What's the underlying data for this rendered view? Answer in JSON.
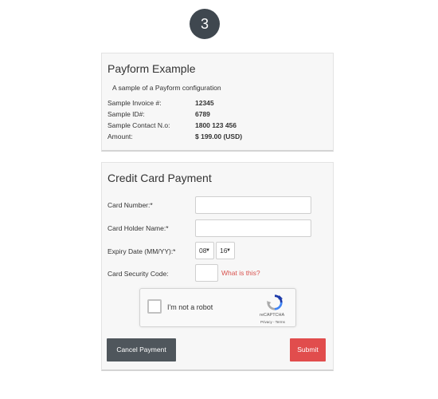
{
  "step": {
    "number": "3"
  },
  "info_panel": {
    "title": "Payform Example",
    "subtitle": "A sample of a Payform configuration",
    "rows": [
      {
        "label": "Sample Invoice #:",
        "value": "12345"
      },
      {
        "label": "Sample ID#:",
        "value": "6789"
      },
      {
        "label": "Sample Contact N.o:",
        "value": "1800 123 456"
      },
      {
        "label": "Amount:",
        "value": "$ 199.00 (USD)"
      }
    ]
  },
  "card_panel": {
    "title": "Credit Card Payment",
    "card_number": {
      "label": "Card Number:*",
      "value": ""
    },
    "holder_name": {
      "label": "Card Holder Name:*",
      "value": ""
    },
    "expiry": {
      "label": "Expiry Date (MM/YY):*",
      "month": "08",
      "year": "16"
    },
    "security": {
      "label": "Card Security Code:",
      "value": "",
      "help_link": "What is this?"
    },
    "recaptcha": {
      "label": "I'm not a robot",
      "brand": "reCAPTCHA",
      "terms": "Privacy - Terms"
    },
    "buttons": {
      "cancel": "Cancel Payment",
      "submit": "Submit"
    }
  },
  "colors": {
    "badge": "#3f474f",
    "cancel_button": "#4f565c",
    "submit_button": "#e14d4d",
    "link": "#d9534f"
  }
}
